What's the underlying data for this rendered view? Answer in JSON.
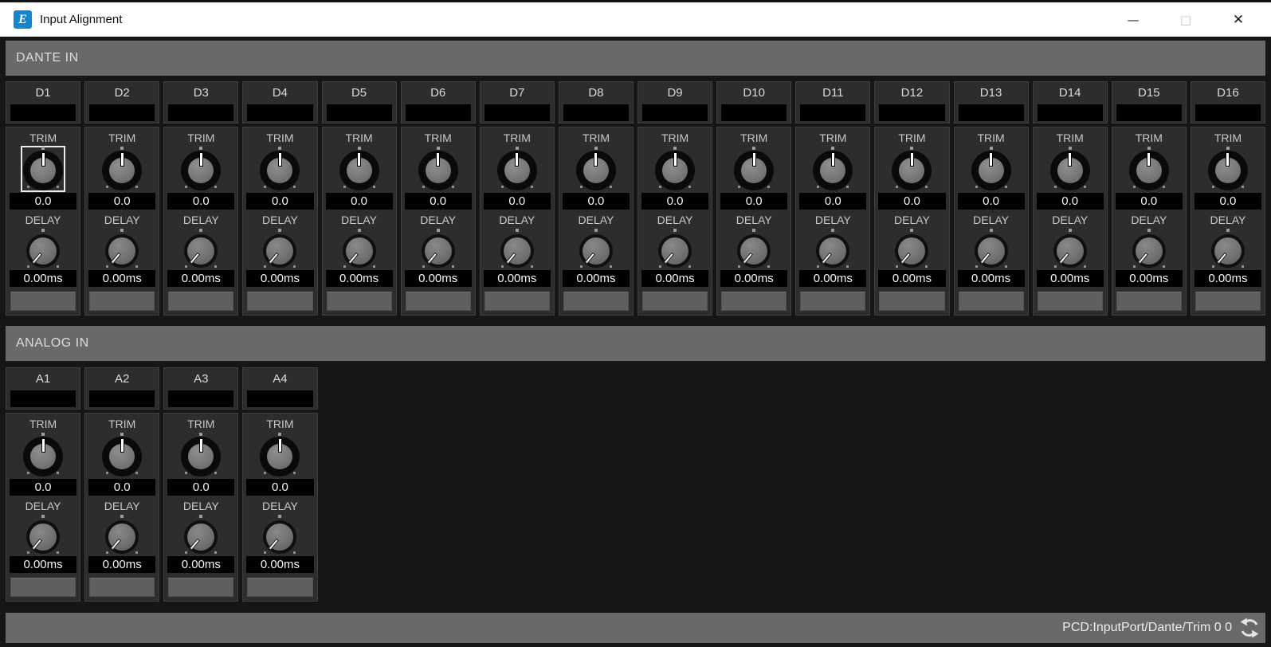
{
  "titlebar": {
    "title": "Input Alignment",
    "app_icon_letter": "E"
  },
  "icons": {
    "minimize": "—",
    "maximize": "□",
    "close": "✕"
  },
  "labels": {
    "trim": "TRIM",
    "delay": "DELAY"
  },
  "sections": [
    {
      "label": "DANTE IN",
      "channels": [
        {
          "name": "D1",
          "port_label": "",
          "trim_value": "0.0",
          "delay_value": "0.00ms",
          "selected": true
        },
        {
          "name": "D2",
          "port_label": "",
          "trim_value": "0.0",
          "delay_value": "0.00ms"
        },
        {
          "name": "D3",
          "port_label": "",
          "trim_value": "0.0",
          "delay_value": "0.00ms"
        },
        {
          "name": "D4",
          "port_label": "",
          "trim_value": "0.0",
          "delay_value": "0.00ms"
        },
        {
          "name": "D5",
          "port_label": "",
          "trim_value": "0.0",
          "delay_value": "0.00ms"
        },
        {
          "name": "D6",
          "port_label": "",
          "trim_value": "0.0",
          "delay_value": "0.00ms"
        },
        {
          "name": "D7",
          "port_label": "",
          "trim_value": "0.0",
          "delay_value": "0.00ms"
        },
        {
          "name": "D8",
          "port_label": "",
          "trim_value": "0.0",
          "delay_value": "0.00ms"
        },
        {
          "name": "D9",
          "port_label": "",
          "trim_value": "0.0",
          "delay_value": "0.00ms"
        },
        {
          "name": "D10",
          "port_label": "",
          "trim_value": "0.0",
          "delay_value": "0.00ms"
        },
        {
          "name": "D11",
          "port_label": "",
          "trim_value": "0.0",
          "delay_value": "0.00ms"
        },
        {
          "name": "D12",
          "port_label": "",
          "trim_value": "0.0",
          "delay_value": "0.00ms"
        },
        {
          "name": "D13",
          "port_label": "",
          "trim_value": "0.0",
          "delay_value": "0.00ms"
        },
        {
          "name": "D14",
          "port_label": "",
          "trim_value": "0.0",
          "delay_value": "0.00ms"
        },
        {
          "name": "D15",
          "port_label": "",
          "trim_value": "0.0",
          "delay_value": "0.00ms"
        },
        {
          "name": "D16",
          "port_label": "",
          "trim_value": "0.0",
          "delay_value": "0.00ms"
        }
      ]
    },
    {
      "label": "ANALOG IN",
      "channels": [
        {
          "name": "A1",
          "port_label": "",
          "trim_value": "0.0",
          "delay_value": "0.00ms"
        },
        {
          "name": "A2",
          "port_label": "",
          "trim_value": "0.0",
          "delay_value": "0.00ms"
        },
        {
          "name": "A3",
          "port_label": "",
          "trim_value": "0.0",
          "delay_value": "0.00ms"
        },
        {
          "name": "A4",
          "port_label": "",
          "trim_value": "0.0",
          "delay_value": "0.00ms"
        }
      ]
    }
  ],
  "statusbar": {
    "parameter_path": "PCD:InputPort/Dante/Trim 0 0"
  }
}
